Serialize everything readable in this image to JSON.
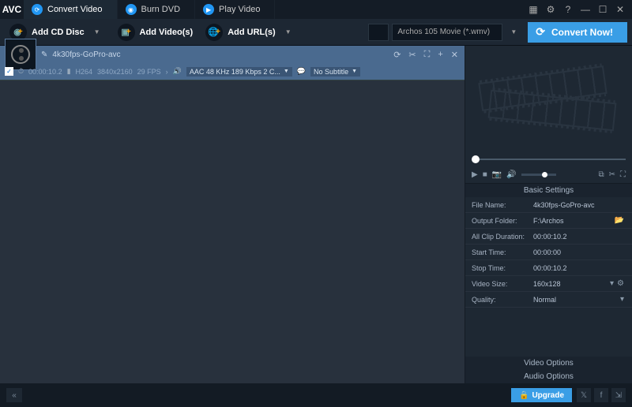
{
  "app": {
    "logo": "AVC"
  },
  "tabs": [
    {
      "label": "Convert Video"
    },
    {
      "label": "Burn DVD"
    },
    {
      "label": "Play Video"
    }
  ],
  "toolbar": {
    "add_cd": "Add CD Disc",
    "add_videos": "Add Video(s)",
    "add_urls": "Add URL(s)",
    "profile": "Archos 105 Movie (*.wmv)",
    "convert": "Convert Now!"
  },
  "item": {
    "title": "4k30fps-GoPro-avc",
    "duration": "00:00:10.2",
    "codec": "H264",
    "res": "3840x2160",
    "fps": "29 FPS",
    "audio": "AAC 48 KHz 189 Kbps 2 C...",
    "subtitle": "No Subtitle"
  },
  "settings": {
    "header": "Basic Settings",
    "rows": [
      {
        "label": "File Name:",
        "value": "4k30fps-GoPro-avc"
      },
      {
        "label": "Output Folder:",
        "value": "F:\\Archos"
      },
      {
        "label": "All Clip Duration:",
        "value": "00:00:10.2"
      },
      {
        "label": "Start Time:",
        "value": "00:00:00"
      },
      {
        "label": "Stop Time:",
        "value": "00:00:10.2"
      },
      {
        "label": "Video Size:",
        "value": "160x128"
      },
      {
        "label": "Quality:",
        "value": "Normal"
      }
    ],
    "video_opts": "Video Options",
    "audio_opts": "Audio Options"
  },
  "footer": {
    "upgrade": "Upgrade"
  }
}
